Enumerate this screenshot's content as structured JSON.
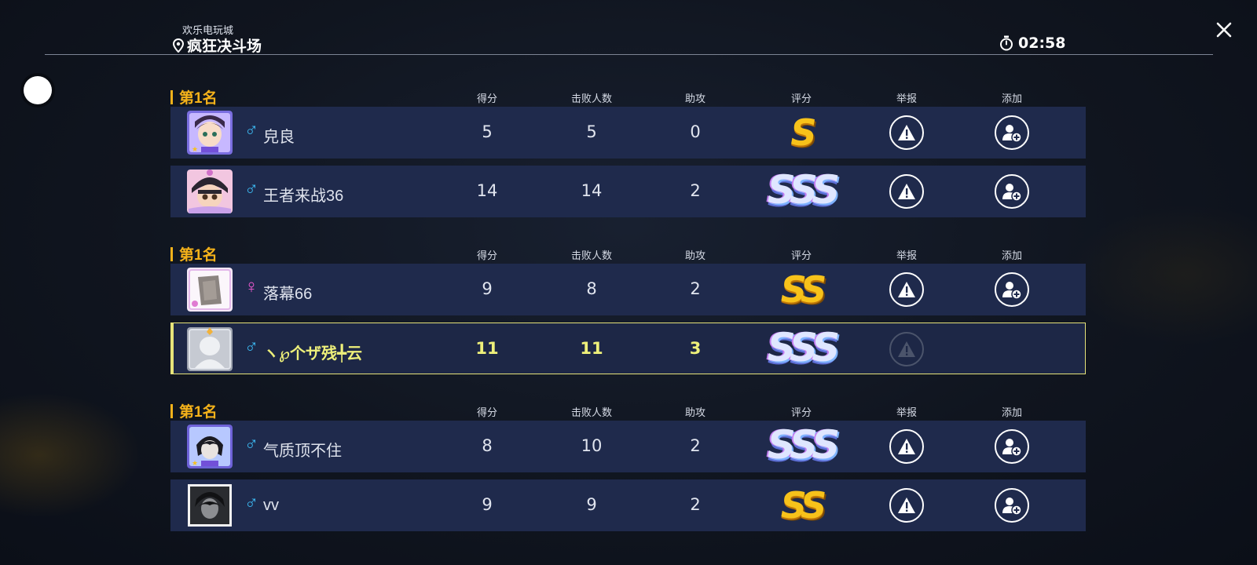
{
  "header": {
    "venue_sub": "欢乐电玩城",
    "venue_name": "疯狂决斗场",
    "timer": "02:58"
  },
  "columns": {
    "score": "得分",
    "defeats": "击败人数",
    "assists": "助攻",
    "rating": "评分",
    "report": "举报",
    "add": "添加"
  },
  "colors": {
    "accent_gold": "#f5b21a",
    "row_bg": "#1f2a4c",
    "self_highlight": "#e6e37a",
    "male": "#3cb9f2",
    "female": "#f05ad2"
  },
  "groups": [
    {
      "rank": "第1名",
      "players": [
        {
          "gender": "♂",
          "name": "皃良",
          "score": "5",
          "defeats": "5",
          "assists": "0",
          "rating": "S"
        },
        {
          "gender": "♂",
          "name": "王者来战36",
          "score": "14",
          "defeats": "14",
          "assists": "2",
          "rating": "SSS"
        }
      ]
    },
    {
      "rank": "第1名",
      "players": [
        {
          "gender": "♀",
          "name": "落幕66",
          "score": "9",
          "defeats": "8",
          "assists": "2",
          "rating": "SS"
        },
        {
          "gender": "♂",
          "name": "ヽ℘个ザ残╇云",
          "score": "11",
          "defeats": "11",
          "assists": "3",
          "rating": "SSS"
        }
      ]
    },
    {
      "rank": "第1名",
      "players": [
        {
          "gender": "♂",
          "name": "气质顶不住",
          "score": "8",
          "defeats": "10",
          "assists": "2",
          "rating": "SSS"
        },
        {
          "gender": "♂",
          "name": "vv",
          "score": "9",
          "defeats": "9",
          "assists": "2",
          "rating": "SS"
        }
      ]
    }
  ]
}
